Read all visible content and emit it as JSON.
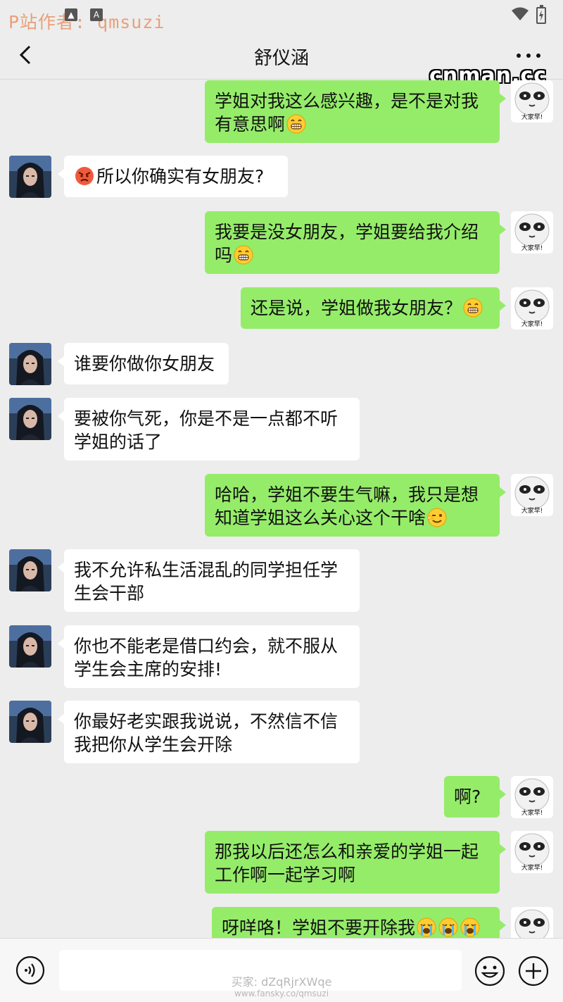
{
  "watermarks": {
    "top_left": "P站作者: qmsuzi",
    "top_right": "cnman.cc",
    "bottom_line1": "买家: dZqRjrXWqe",
    "bottom_line2": "www.fansky.co/qmsuzi"
  },
  "status_bar": {
    "icons": [
      "image-icon",
      "a-icon",
      "wifi-icon",
      "battery-charging-icon"
    ]
  },
  "header": {
    "title": "舒仪涵",
    "back_icon": "chevron-left-icon",
    "more_icon": "more-dots-icon"
  },
  "contact": {
    "me_avatar_text": "大家早!"
  },
  "messages": [
    {
      "from": "me",
      "text": "学姐对我这么感兴趣，是不是对我有意思啊",
      "emoji": [
        "grin"
      ]
    },
    {
      "from": "them",
      "text": "所以你确实有女朋友?",
      "emoji_before": [
        "angry"
      ]
    },
    {
      "from": "me",
      "text": "我要是没女朋友，学姐要给我介绍吗",
      "emoji": [
        "grin"
      ]
    },
    {
      "from": "me",
      "text": "还是说，学姐做我女朋友？",
      "emoji": [
        "grin"
      ]
    },
    {
      "from": "them",
      "text": "谁要你做你女朋友"
    },
    {
      "from": "them",
      "text": "要被你气死，你是不是一点都不听学姐的话了"
    },
    {
      "from": "me",
      "text": "哈哈，学姐不要生气嘛，我只是想知道学姐这么关心这个干啥",
      "emoji": [
        "wink"
      ]
    },
    {
      "from": "them",
      "text": "我不允许私生活混乱的同学担任学生会干部"
    },
    {
      "from": "them",
      "text": "你也不能老是借口约会，就不服从学生会主席的安排!"
    },
    {
      "from": "them",
      "text": "你最好老实跟我说说，不然信不信我把你从学生会开除"
    },
    {
      "from": "me",
      "text": "啊?"
    },
    {
      "from": "me",
      "text": "那我以后还怎么和亲爱的学姐一起工作啊一起学习啊"
    },
    {
      "from": "me",
      "text": "呀咩咯！学姐不要开除我",
      "emoji": [
        "cry",
        "cry",
        "cry"
      ]
    }
  ],
  "input_bar": {
    "voice_icon": "voice-icon",
    "emoji_icon": "emoji-icon",
    "plus_icon": "plus-icon"
  },
  "colors": {
    "background": "#ededed",
    "my_bubble": "#95ec69",
    "their_bubble": "#ffffff"
  }
}
